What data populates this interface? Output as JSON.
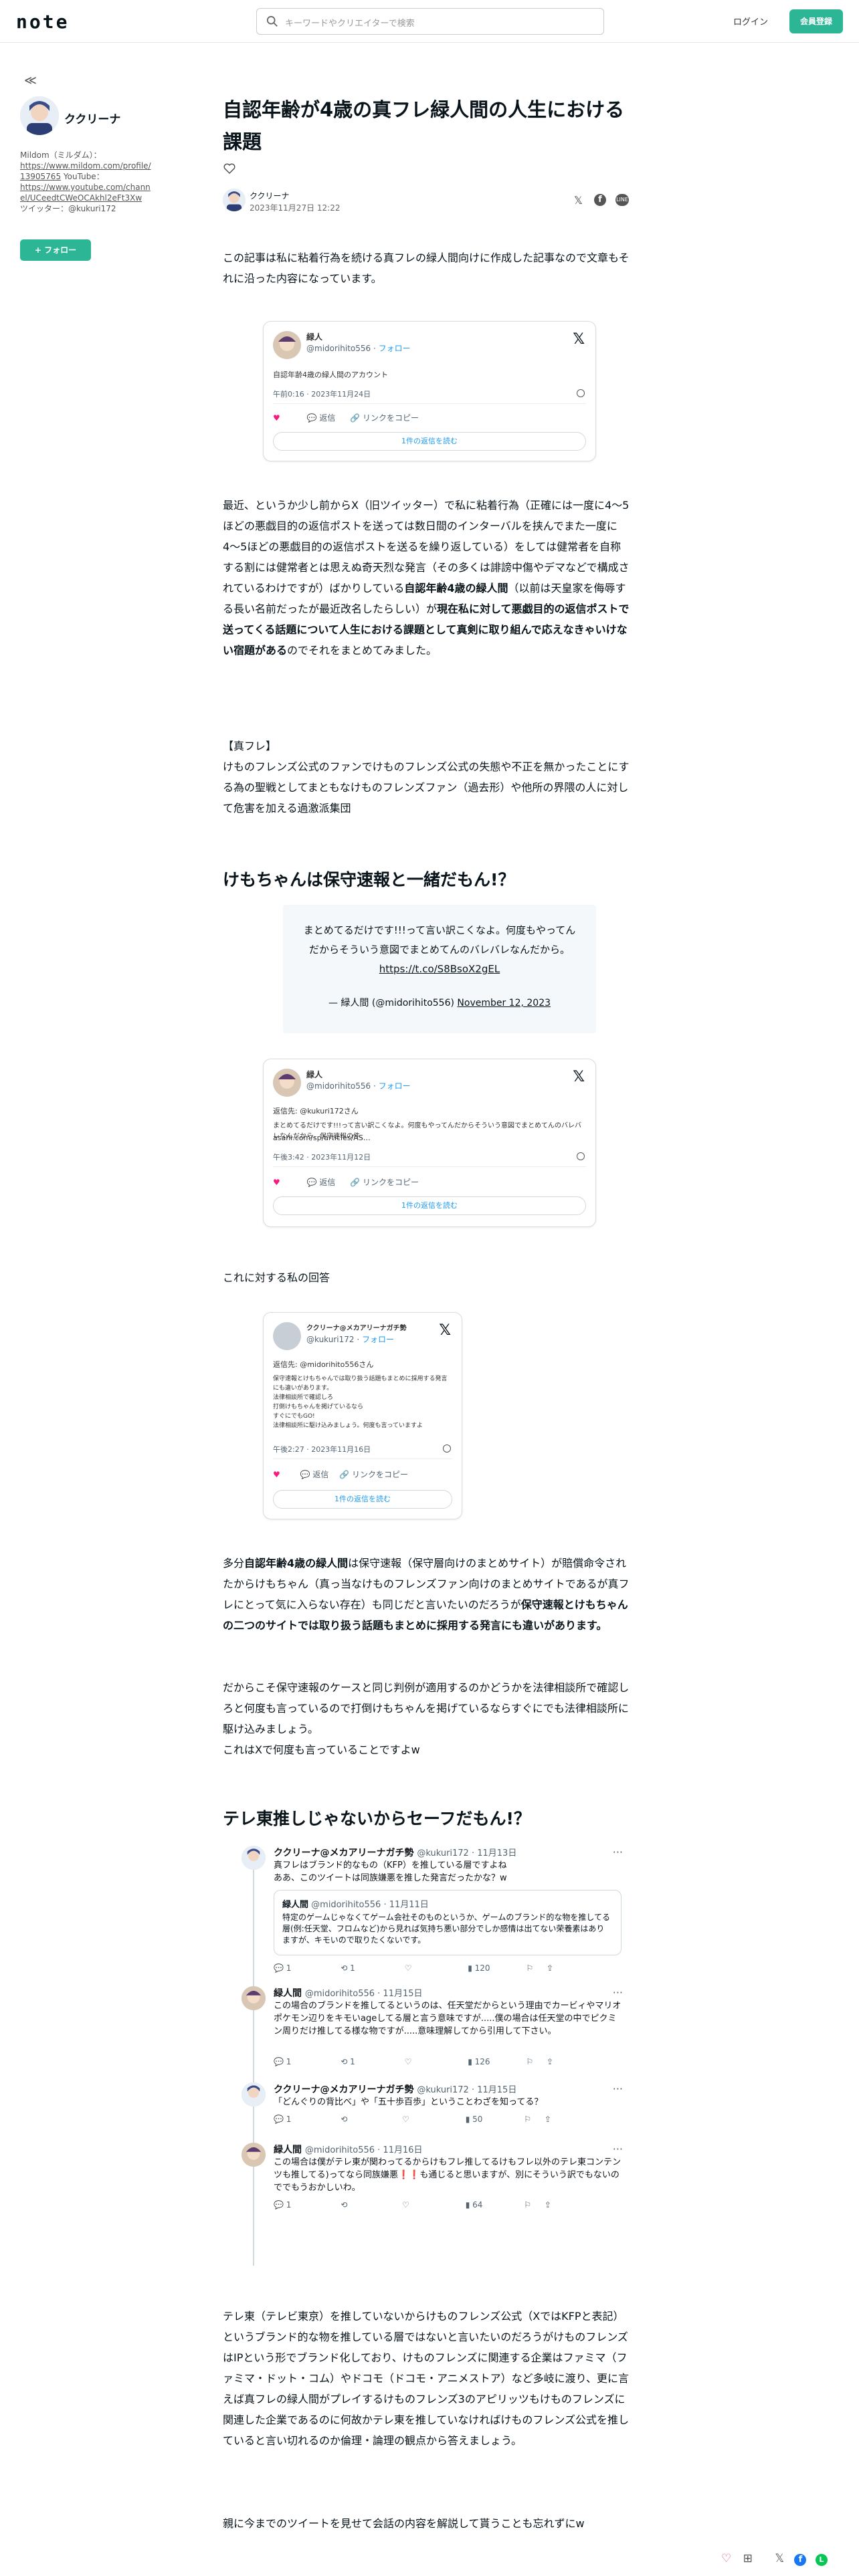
{
  "header": {
    "logo": "note",
    "search_placeholder": "キーワードやクリエイターで検索",
    "login": "ログイン",
    "signup": "会員登録"
  },
  "sidebar": {
    "back": "≪",
    "name": "ククリーナ",
    "bio1": "Mildom（ミルダム）：",
    "bio_link1": "https://www.mildom.com/profile/13905765",
    "bio2": " YouTube：",
    "bio_link2": "https://www.youtube.com/channel/UCeedtCWeOCAkhl2eFt3Xw",
    "bio3": "ツイッター：@kukuri172",
    "follow": "+ フォロー"
  },
  "article": {
    "title": "自認年齢が4歳の真フレ緑人間の人生における課題",
    "author": "ククリーナ",
    "date": "2023年11月27日 12:22",
    "intro": "この記事は私に粘着行為を続ける真フレの緑人間向けに作成した記事なので文章もそれに沿った内容になっています。",
    "p2_a": "最近、というか少し前からX（旧ツイッター）で私に粘着行為（正確には一度に4〜5ほどの悪戯目的の返信ポストを送っては数日間のインターバルを挟んでまた一度に4〜5ほどの悪戯目的の返信ポストを送るを繰り返している）をしては健常者を自称する割には健常者とは思えぬ奇天烈な発言（その多くは誹謗中傷やデマなどで構成されているわけですが）ばかりしている",
    "p2_b": "自認年齢4歳の緑人間",
    "p2_c": "（以前は天皇家を侮辱する長い名前だったが最近改名したらしい）が",
    "p2_d": "現在私に対して悪戯目的の返信ポストで送ってくる話題について人生における課題として真剣に取り組んで応えなきゃいけない宿題がある",
    "p2_e": "のでそれをまとめてみました。",
    "p3_h": "【真フレ】",
    "p3": "けものフレンズ公式のファンでけものフレンズ公式の失態や不正を無かったことにする為の聖戦としてまともなけものフレンズファン（過去形）や他所の界隈の人に対して危害を加える過激派集団",
    "h2_1": "けもちゃんは保守速報と一緒だもん!？",
    "quote_text": "まとめてるだけです!!!って言い訳こくなよ。何度もやってんだからそういう意図でまとめてんのバレバレなんだから。",
    "quote_link": "https://t.co/S8BsoX2gEL",
    "quote_attr_a": "— 緑人間 (@midorihito556)",
    "quote_attr_date": "November 12, 2023",
    "reply_label": "これに対する私の回答",
    "p4_a": "多分",
    "p4_b": "自認年齢4歳の緑人間",
    "p4_c": "は保守速報（保守層向けのまとめサイト）が賠償命令されたからけもちゃん（真っ当なけものフレンズファン向けのまとめサイトであるが真フレにとって気に入らない存在）も同じだと言いたいのだろうが",
    "p4_d": "保守速報とけもちゃんの二つのサイトでは取り扱う話題もまとめに採用する発言にも違いがあります。",
    "p4_e": "だからこそ保守速報のケースと同じ判例が適用するのかどうかを法律相談所で確認しろと何度も言っているので打倒けもちゃんを掲げているならすぐにでも法律相談所に駆け込みましょう。",
    "p4_f": "これはXで何度も言っていることですよw",
    "h2_2": "テレ東推しじゃないからセーフだもん!？",
    "p5": "テレ東（テレビ東京）を推していないからけものフレンズ公式（XではKFPと表記）というブランド的な物を推している層ではないと言いたいのだろうがけものフレンズはIPという形でブランド化しており、けものフレンズに関連する企業はファミマ（ファミマ・ドット・コム）やドコモ（ドコモ・アニメストア）など多岐に渡り、更に言えば真フレの緑人間がプレイするけものフレンズ3のアピリッツもけものフレンズに関連した企業であるのに何故かテレ東を推していなければけものフレンズ公式を推していると言い切れるのか倫理・論理の観点から答えましょう。",
    "p6": "親に今までのツイートを見せて会話の内容を解説して貰うことも忘れずにw"
  },
  "embed1": {
    "name": "緑人",
    "handle": "@midorihito556",
    "follow": "フォロー",
    "text": "自認年齢4歳の緑人間のアカウント",
    "time": "午前0:16 · 2023年11月24日",
    "like": "",
    "reply": "返信",
    "copy": "リンクをコピー",
    "button": "1件の返信を読む"
  },
  "embed2": {
    "name": "緑人",
    "handle": "@midorihito556",
    "follow": "フォロー",
    "reply_to": "返信先: @kukuri172さん",
    "text": "まとめてるだけです!!!って言い訳こくなよ。何度もやってんだからそういう意図でまとめてんのバレバレなんだから。保守速報の件、",
    "link": "asahi.com/sp/articles/AS…",
    "time": "午後3:42 · 2023年11月12日",
    "reply": "返信",
    "copy": "リンクをコピー",
    "button": "1件の返信を読む"
  },
  "embed3": {
    "name": "ククリーナ@メカアリーナガチ勢",
    "handle": "@kukuri172",
    "follow": "フォロー",
    "reply_to": "返信先: @midorihito556さん",
    "text1": "保守速報とけもちゃんでは取り扱う話題もまとめに採用する発言にも違いがあります。",
    "text2": "法律相談所で確認しろ",
    "text3": "打倒けもちゃんを掲げているなら",
    "text4": "すぐにでもGO!",
    "text5": "法律相談所に駆け込みましょう。何度も言っていますよ",
    "time": "午後2:27 · 2023年11月16日",
    "reply": "返信",
    "copy": "リンクをコピー",
    "button": "1件の返信を読む"
  },
  "thread": {
    "t1": {
      "name": "ククリーナ@メカアリーナガチ勢",
      "meta": "@kukuri172 · 11月13日",
      "text": "真フレはブランド的なもの（KFP）を推している層ですよね\nああ、このツイートは同族嫌悪を推した発言だったかな？w",
      "reply": "1",
      "rt": "",
      "like": "",
      "views": "",
      "quote_name": "緑人間",
      "quote_meta": "@midorihito556 · 11月11日",
      "quote_text": "特定のゲームじゃなくてゲーム会社そのものというか、ゲームのブランド的な物を推してる層(例:任天堂、フロムなど)から見れば気持ち悪い部分でしか感情は出てない荣養素はありますが、キモいので取りたくないです。"
    },
    "t2": {
      "name": "緑人間",
      "meta": "@midorihito556 · 11月15日",
      "text": "この場合のブランドを推してるというのは、任天堂だからという理由でカービィやマリオポケモン辺りをキモいageしてる層と言う意味ですが.....僕の場合は任天堂の中でピクミン周りだけ推してる様な物ですが.....意味理解してから引用して下さい。",
      "reply": "1",
      "rt": "1",
      "like": "",
      "views": "126"
    },
    "t3": {
      "name": "ククリーナ@メカアリーナガチ勢",
      "meta": "@kukuri172 · 11月15日",
      "text": "「どんぐりの背比べ」や「五十歩百歩」ということわざを知ってる？",
      "reply": "1",
      "views": "50"
    },
    "t4": {
      "name": "緑人間",
      "meta": "@midorihito556 · 11月16日",
      "text": "この場合は僕がテレ東が関わってるからけもフレ推してるけもフレ以外のテレ東コンテンツも推してる)ってなら同族嫌悪❗❗も通じると思いますが、別にそういう訳でもないのででもうおかしいわ。",
      "reply": "1",
      "views": "64"
    },
    "t1_rt": "1",
    "t1_views": "120"
  },
  "footer": {
    "like": "♡",
    "magazine": "⊞",
    "x": "𝕏",
    "fb": "f",
    "line": "L"
  },
  "colors": {
    "brand_green": "#2cb696",
    "x_blue": "#1d9bf0",
    "like_pink": "#f91880"
  }
}
